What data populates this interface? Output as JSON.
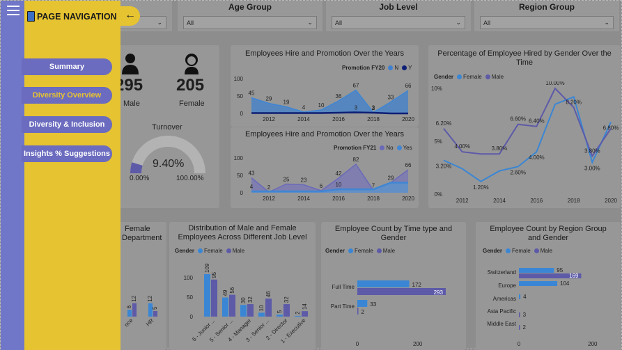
{
  "slicers": [
    {
      "title": "",
      "value": ""
    },
    {
      "title": "Age Group",
      "value": "All"
    },
    {
      "title": "Job Level",
      "value": "All"
    },
    {
      "title": "Region Group",
      "value": "All"
    }
  ],
  "nav": {
    "title": "PAGE NAVIGATION",
    "items": [
      "Summary",
      "Diversity Overview",
      "Diversity & Inclusion",
      "Insights % Suggestions"
    ],
    "colors": {
      "blue": "#7077c8",
      "yellow": "#e6c331",
      "button": "#6b6bbf"
    }
  },
  "kpis": {
    "male_value": "295",
    "male_label": "Male",
    "female_value": "205",
    "female_label": "Female",
    "turnover_title": "Turnover",
    "turnover_value": "9.40%",
    "turnover_min": "0.00%",
    "turnover_max": "100.00%",
    "turnover_fraction": 0.094
  },
  "hire_fy20": {
    "title": "Employees Hire and Promotion Over the Years",
    "legend_title": "Promotion FY20",
    "legend": [
      "N",
      "Y"
    ]
  },
  "hire_fy21": {
    "title": "Employees Hire and Promotion Over the Years",
    "legend_title": "Promotion FY21",
    "legend": [
      "No",
      "Yes"
    ]
  },
  "gender_pct": {
    "title": "Percentage of Employee Hired by Gender Over the Time",
    "legend_title": "Gender",
    "legend": [
      "Female",
      "Male"
    ]
  },
  "dept": {
    "title_line1": "Female",
    "title_line2": "Department"
  },
  "joblevel": {
    "title": "Distribution of Male and Female Employees Across Different Job Level",
    "legend_title": "Gender",
    "legend": [
      "Female",
      "Male"
    ]
  },
  "timetype": {
    "title": "Employee Count by Time type and Gender",
    "legend_title": "Gender",
    "legend": [
      "Female",
      "Male"
    ]
  },
  "region": {
    "title": "Employee Count by Region Group and Gender",
    "legend_title": "Gender",
    "legend": [
      "Female",
      "Male"
    ]
  },
  "colors": {
    "female": "#3a86d4",
    "male": "#5d5aa8",
    "navyN": "#3f7fcf",
    "navyY": "#0d1f75"
  },
  "chart_data": [
    {
      "type": "area",
      "title": "Employees Hire and Promotion Over the Years",
      "x": [
        2011,
        2012,
        2013,
        2014,
        2015,
        2016,
        2017,
        2018,
        2019,
        2020
      ],
      "ylim": [
        0,
        100
      ],
      "yticks": [
        "0",
        "50",
        "100"
      ],
      "xticks": [
        "2012",
        "2014",
        "2016",
        "2018",
        "2020"
      ],
      "series": [
        {
          "name": "N",
          "values": [
            45,
            29,
            19,
            4,
            10,
            36,
            67,
            3,
            33,
            66
          ],
          "labels": [
            "45",
            "29",
            "19",
            "4",
            "10",
            "36",
            "67",
            "3",
            "33",
            "66"
          ]
        },
        {
          "name": "Y",
          "values": [
            1,
            1,
            1,
            1,
            1,
            2,
            3,
            2,
            0,
            0
          ],
          "labels": [
            "",
            "",
            "",
            "",
            "",
            "",
            "3",
            "2",
            "",
            ""
          ]
        }
      ]
    },
    {
      "type": "area",
      "title": "Employees Hire and Promotion Over the Years",
      "x": [
        2011,
        2012,
        2013,
        2014,
        2015,
        2016,
        2017,
        2018,
        2019,
        2020
      ],
      "ylim": [
        0,
        100
      ],
      "yticks": [
        "0",
        "50",
        "100"
      ],
      "xticks": [
        "2012",
        "2014",
        "2016",
        "2018",
        "2020"
      ],
      "series": [
        {
          "name": "No",
          "values": [
            43,
            2,
            25,
            23,
            6,
            42,
            82,
            7,
            29,
            66
          ],
          "labels": [
            "43",
            "2",
            "25",
            "23",
            "6",
            "42",
            "82",
            "7",
            "29",
            "66"
          ]
        },
        {
          "name": "Yes",
          "values": [
            4,
            4,
            4,
            4,
            4,
            10,
            10,
            10,
            29,
            29
          ],
          "labels": [
            "4",
            "",
            "",
            "",
            "",
            "10",
            "",
            "",
            "",
            ""
          ]
        }
      ]
    },
    {
      "type": "line",
      "title": "Percentage of Employee Hired by Gender Over the Time",
      "x": [
        2011,
        2012,
        2013,
        2014,
        2015,
        2016,
        2017,
        2018,
        2019,
        2020
      ],
      "ylim": [
        0,
        10
      ],
      "yticks": [
        "0%",
        "5%",
        "10%"
      ],
      "xticks": [
        "2012",
        "2014",
        "2016",
        "2018",
        "2020"
      ],
      "series": [
        {
          "name": "Female",
          "values": [
            3.2,
            2.4,
            1.2,
            2.2,
            2.6,
            4.0,
            8.5,
            9.2,
            3.0,
            6.8
          ],
          "labels": [
            "3.20%",
            "",
            "1.20%",
            "",
            "2.60%",
            "4.00%",
            "",
            "",
            "3.00%",
            "6.80%"
          ]
        },
        {
          "name": "Male",
          "values": [
            6.2,
            4.0,
            3.8,
            3.8,
            6.6,
            6.4,
            10.0,
            8.2,
            3.6,
            6.2
          ],
          "labels": [
            "6.20%",
            "4.00%",
            "",
            "3.80%",
            "6.60%",
            "6.40%",
            "10.00%",
            "8.20%",
            "3.80%",
            ""
          ]
        }
      ]
    },
    {
      "type": "bar",
      "title": "Female Department",
      "categories": [
        "nce",
        "HR"
      ],
      "series": [
        {
          "name": "Female",
          "values": [
            6,
            12
          ]
        },
        {
          "name": "Male",
          "values": [
            12,
            5
          ]
        }
      ]
    },
    {
      "type": "bar",
      "title": "Distribution of Male and Female Employees Across Different Job Level",
      "ylim": [
        0,
        100
      ],
      "yticks": [
        "0",
        "50",
        "100"
      ],
      "categories": [
        "6 - Junior ...",
        "5 - Senior ...",
        "4 - Manager",
        "3 - Senior ...",
        "2 - Director",
        "1 - Executive"
      ],
      "series": [
        {
          "name": "Female",
          "values": [
            109,
            49,
            30,
            10,
            5,
            2
          ]
        },
        {
          "name": "Male",
          "values": [
            95,
            56,
            32,
            46,
            32,
            14
          ]
        }
      ]
    },
    {
      "type": "bar",
      "title": "Employee Count by Time type and Gender",
      "xticks": [
        "0",
        "200"
      ],
      "xlim": [
        0,
        300
      ],
      "categories": [
        "Full Time",
        "Part Time"
      ],
      "series": [
        {
          "name": "Female",
          "values": [
            172,
            33
          ]
        },
        {
          "name": "Male",
          "values": [
            293,
            2
          ]
        }
      ]
    },
    {
      "type": "bar",
      "title": "Employee Count by Region Group and Gender",
      "xticks": [
        "0",
        "200"
      ],
      "xlim": [
        0,
        240
      ],
      "categories": [
        "Switzerland",
        "Europe",
        "Americas",
        "Asia Pacific",
        "Middle East"
      ],
      "series": [
        {
          "name": "Female",
          "values": [
            95,
            104,
            4,
            0,
            0
          ]
        },
        {
          "name": "Male",
          "values": [
            169,
            0,
            0,
            3,
            2
          ]
        }
      ]
    }
  ]
}
